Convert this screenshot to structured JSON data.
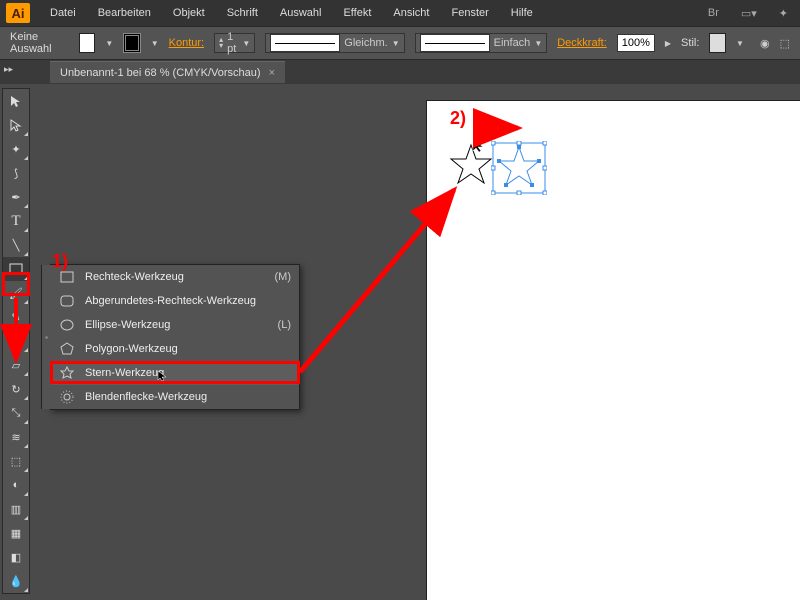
{
  "menubar": {
    "items": [
      "Datei",
      "Bearbeiten",
      "Objekt",
      "Schrift",
      "Auswahl",
      "Effekt",
      "Ansicht",
      "Fenster",
      "Hilfe"
    ]
  },
  "controlbar": {
    "selection": "Keine Auswahl",
    "stroke_label": "Kontur:",
    "stroke_pt": "1 pt",
    "stroke_style": "Gleichm.",
    "arrow_style": "Einfach",
    "opacity_label": "Deckkraft:",
    "opacity_value": "100%",
    "style_label": "Stil:"
  },
  "tab": {
    "title": "Unbenannt-1 bei 68 % (CMYK/Vorschau)"
  },
  "flyout": {
    "items": [
      {
        "label": "Rechteck-Werkzeug",
        "shortcut": "(M)",
        "icon": "rect"
      },
      {
        "label": "Abgerundetes-Rechteck-Werkzeug",
        "shortcut": "",
        "icon": "roundrect"
      },
      {
        "label": "Ellipse-Werkzeug",
        "shortcut": "(L)",
        "icon": "ellipse"
      },
      {
        "label": "Polygon-Werkzeug",
        "shortcut": "",
        "icon": "polygon"
      },
      {
        "label": "Stern-Werkzeug",
        "shortcut": "",
        "icon": "star"
      },
      {
        "label": "Blendenflecke-Werkzeug",
        "shortcut": "",
        "icon": "flare"
      }
    ]
  },
  "annotations": {
    "label1": "1)",
    "label2": "2)"
  }
}
